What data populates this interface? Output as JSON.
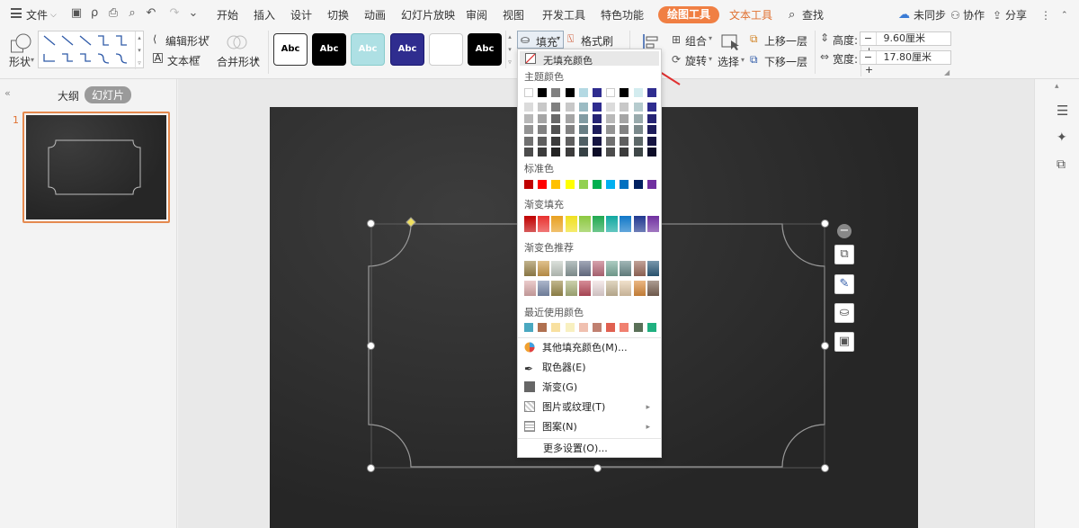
{
  "menubar": {
    "file_label": "文件",
    "tabs": [
      "开始",
      "插入",
      "设计",
      "切换",
      "动画",
      "幻灯片放映",
      "审阅",
      "视图",
      "开发工具",
      "特色功能"
    ],
    "active_tab": "绘图工具",
    "text_tool_tab": "文本工具",
    "search_label": "查找",
    "sync_label": "未同步",
    "collab_label": "协作",
    "share_label": "分享"
  },
  "ribbon": {
    "shape_label": "形状",
    "edit_shape_label": "编辑形状",
    "textbox_label": "文本框",
    "merge_shape_label": "合并形状",
    "style_label": "Abc",
    "fill_label": "填充",
    "format_brush_label": "格式刷",
    "group_label": "组合",
    "rotate_label": "旋转",
    "select_label": "选择",
    "bring_forward_label": "上移一层",
    "send_backward_label": "下移一层",
    "height_label": "高度:",
    "height_value": "9.60厘米",
    "width_label": "宽度:",
    "width_value": "17.80厘米",
    "minus": "−",
    "plus": "+"
  },
  "left_panel": {
    "outline_tab": "大纲",
    "slides_tab": "幻灯片",
    "slide_number": "1",
    "collapse_icon": "«"
  },
  "fill_dropdown": {
    "no_fill": "无填充颜色",
    "theme_colors_title": "主题颜色",
    "standard_colors_title": "标准色",
    "gradient_fill_title": "渐变填充",
    "gradient_recommend_title": "渐变色推荐",
    "recent_colors_title": "最近使用颜色",
    "more_fill_colors": "其他填充颜色(M)...",
    "eyedropper": "取色器(E)",
    "gradient": "渐变(G)",
    "picture_texture": "图片或纹理(T)",
    "pattern": "图案(N)",
    "more_settings": "更多设置(O)...",
    "theme_top_row": [
      "#ffffff",
      "#000000",
      "#808080",
      "#000000",
      "#b4d9e3",
      "#2f2d8f",
      "#ffffff",
      "#000000",
      "#d3ecef",
      "#2f2d8f"
    ],
    "standard_colors": [
      "#c00000",
      "#ff0000",
      "#ffc000",
      "#ffff00",
      "#92d050",
      "#00b050",
      "#00b0f0",
      "#0070c0",
      "#002060",
      "#7030a0"
    ],
    "gradient_colors": [
      "#c00000",
      "#e8312f",
      "#e8a020",
      "#f0e020",
      "#8cc840",
      "#20a850",
      "#10a8a0",
      "#1078c8",
      "#203890",
      "#7030a0"
    ],
    "recommend_row1": [
      "#a08a50",
      "#d0a050",
      "#c8d0c8",
      "#90a0a0",
      "#707890",
      "#c07080",
      "#80b0a0",
      "#709090",
      "#a07060",
      "#306080"
    ],
    "recommend_row2": [
      "#e0b0b0",
      "#8090b0",
      "#a09050",
      "#b0b880",
      "#c05060",
      "#f0e0e0",
      "#d0c0a0",
      "#e8d0b0",
      "#e09040",
      "#806858"
    ],
    "recent_colors": [
      "#4aa8c0",
      "#b07050",
      "#f8e0a0",
      "#f8f0c0",
      "#f0c0b0",
      "#c08070",
      "#e06050",
      "#f08070",
      "#5a7058",
      "#20b080"
    ]
  }
}
